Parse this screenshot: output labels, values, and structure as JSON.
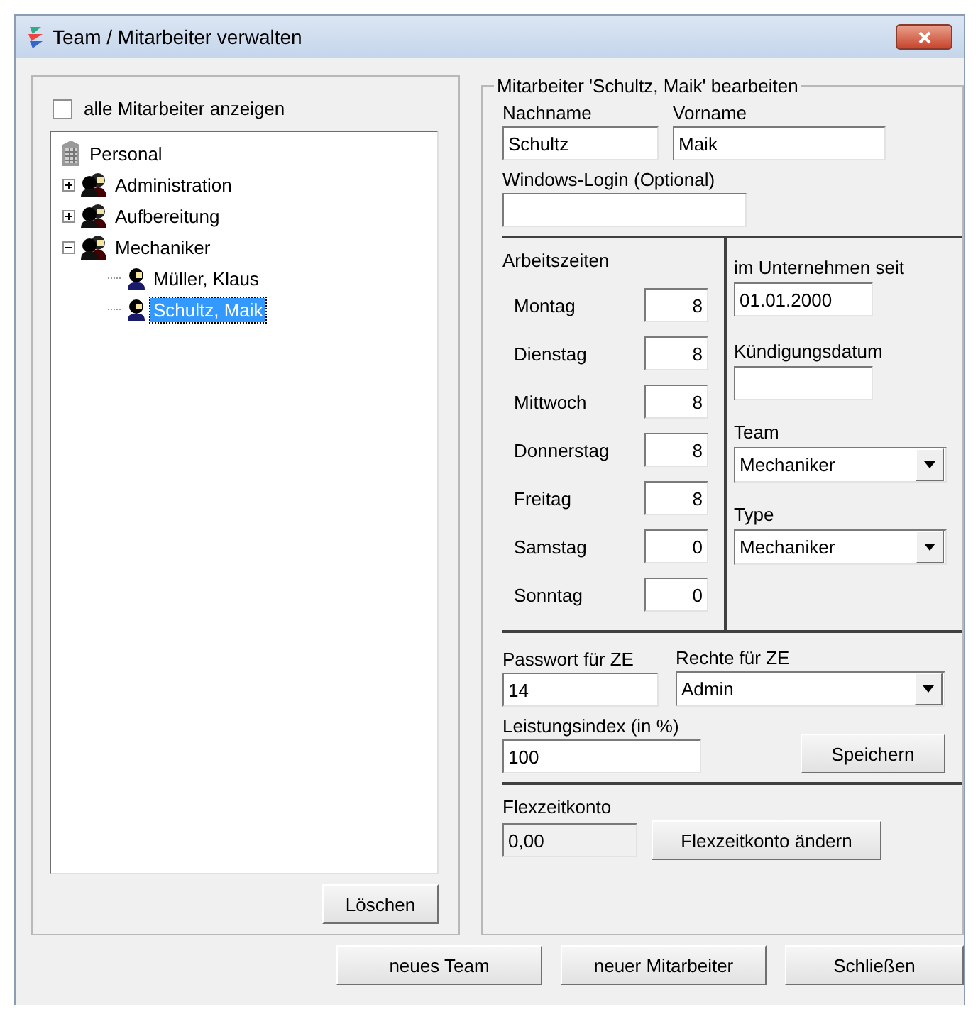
{
  "window": {
    "title": "Team / Mitarbeiter verwalten"
  },
  "left": {
    "show_all": {
      "label": "alle Mitarbeiter anzeigen",
      "checked": false
    },
    "tree": [
      {
        "label": "Personal",
        "kind": "root",
        "selected": false,
        "children": [
          {
            "label": "Administration",
            "kind": "team",
            "expanded": false,
            "selected": false
          },
          {
            "label": "Aufbereitung",
            "kind": "team",
            "expanded": false,
            "selected": false
          },
          {
            "label": "Mechaniker",
            "kind": "team",
            "expanded": true,
            "selected": false,
            "children": [
              {
                "label": "Müller, Klaus",
                "kind": "person",
                "selected": false
              },
              {
                "label": "Schultz, Maik",
                "kind": "person",
                "selected": true
              }
            ]
          }
        ]
      }
    ],
    "delete_button": "Löschen"
  },
  "editor": {
    "legend": "Mitarbeiter 'Schultz, Maik' bearbeiten",
    "lastname": {
      "label": "Nachname",
      "value": "Schultz"
    },
    "firstname": {
      "label": "Vorname",
      "value": "Maik"
    },
    "login": {
      "label": "Windows-Login (Optional)"
    },
    "hours_title": "Arbeitszeiten",
    "hours": [
      {
        "day": "Montag",
        "value": "8"
      },
      {
        "day": "Dienstag",
        "value": "8"
      },
      {
        "day": "Mittwoch",
        "value": "8"
      },
      {
        "day": "Donnerstag",
        "value": "8"
      },
      {
        "day": "Freitag",
        "value": "8"
      },
      {
        "day": "Samstag",
        "value": "0"
      },
      {
        "day": "Sonntag",
        "value": "0"
      }
    ],
    "since": {
      "label": "im Unternehmen seit",
      "value": "01.01.2000"
    },
    "termination": {
      "label": "Kündigungsdatum"
    },
    "team": {
      "label": "Team",
      "value": "Mechaniker"
    },
    "type": {
      "label": "Type",
      "value": "Mechaniker"
    },
    "password": {
      "label": "Passwort für ZE",
      "value": "14"
    },
    "rights": {
      "label": "Rechte für ZE",
      "value": "Admin"
    },
    "performance": {
      "label": "Leistungsindex (in %)",
      "value": "100"
    },
    "save_button": "Speichern",
    "flex": {
      "label": "Flexzeitkonto",
      "value": "0,00",
      "button": "Flexzeitkonto ändern"
    }
  },
  "buttons": [
    "neues Team",
    "neuer Mitarbeiter",
    "Schließen"
  ]
}
